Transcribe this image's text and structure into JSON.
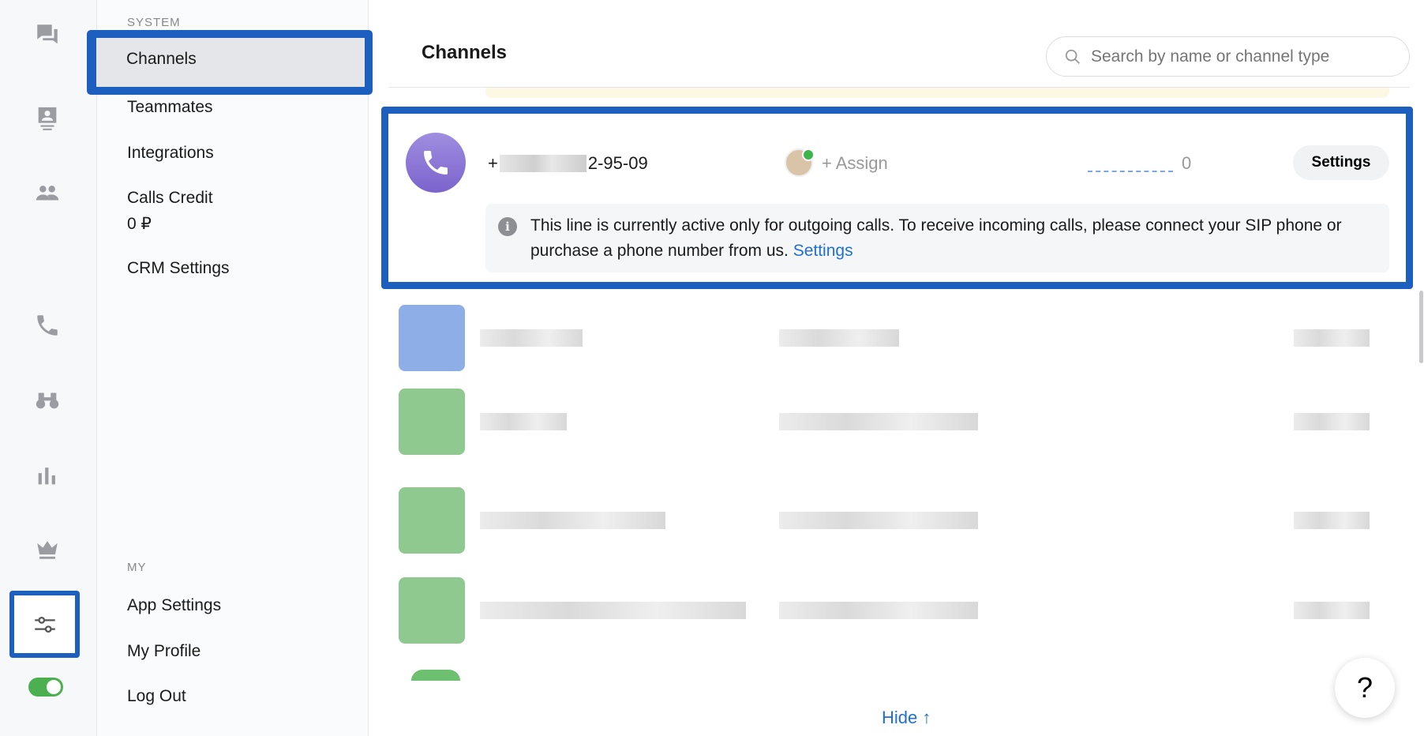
{
  "rail": {
    "icons": [
      "chat-icon",
      "contacts-icon",
      "team-icon",
      "phone-icon",
      "binoculars-icon",
      "stats-icon",
      "crown-icon",
      "settings-sliders-icon"
    ]
  },
  "sidebar": {
    "system_label": "SYSTEM",
    "items": [
      {
        "label": "Channels"
      },
      {
        "label": "Teammates"
      },
      {
        "label": "Integrations"
      },
      {
        "label": "Calls Credit"
      },
      {
        "label": "CRM Settings"
      }
    ],
    "calls_credit_value": "0 ₽",
    "my_label": "MY",
    "my_items": [
      {
        "label": "App Settings"
      },
      {
        "label": "My Profile"
      },
      {
        "label": "Log Out"
      }
    ]
  },
  "header": {
    "title": "Channels",
    "search_placeholder": "Search by name or channel type"
  },
  "channel": {
    "number_prefix": "+",
    "number_suffix": "2-95-09",
    "assign_label": "+ Assign",
    "count": "0",
    "settings_label": "Settings",
    "info_text": "This line is currently active only for outgoing calls. To receive incoming calls, please connect your SIP phone or purchase a phone number from us.",
    "info_link": "Settings"
  },
  "footer": {
    "hide_label": "Hide ↑",
    "help_label": "?"
  },
  "colors": {
    "accent": "#1d5fbf",
    "link": "#1f6fd1",
    "phone_avatar": "#8b76d6"
  }
}
